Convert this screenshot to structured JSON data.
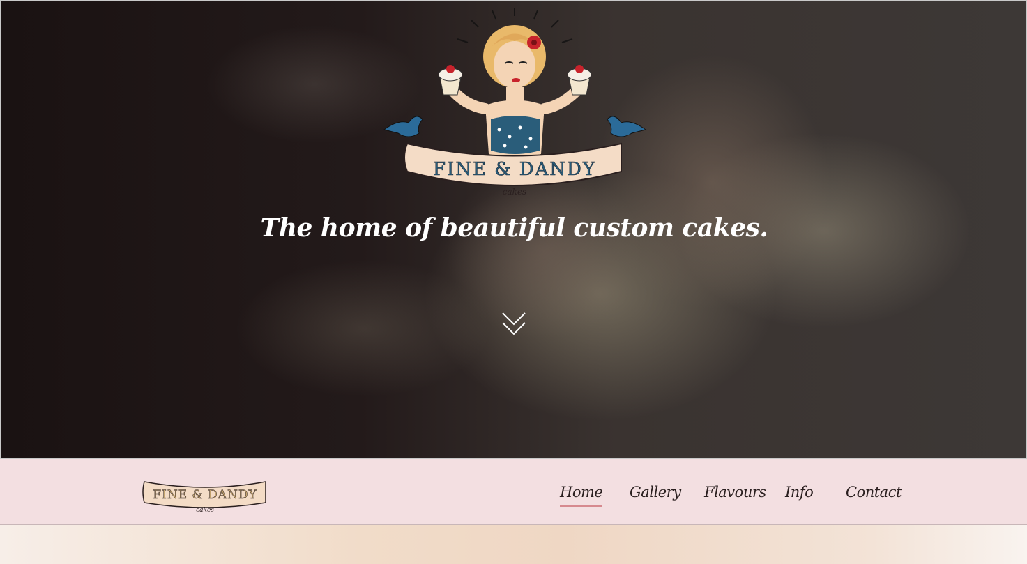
{
  "hero": {
    "tagline": "The home of beautiful custom cakes.",
    "logo_text": "FINE & DANDY",
    "logo_sub": "cakes",
    "scroll_icon": "double-chevron-down-icon"
  },
  "navbar": {
    "logo_text": "FINE & DANDY",
    "logo_sub": "cakes",
    "active_color": "#d68a8f",
    "links": [
      {
        "label": "Home",
        "active": true
      },
      {
        "label": "Gallery",
        "active": false
      },
      {
        "label": "Flavours",
        "active": false
      },
      {
        "label": "Info",
        "active": false
      },
      {
        "label": "Contact",
        "active": false
      }
    ]
  }
}
